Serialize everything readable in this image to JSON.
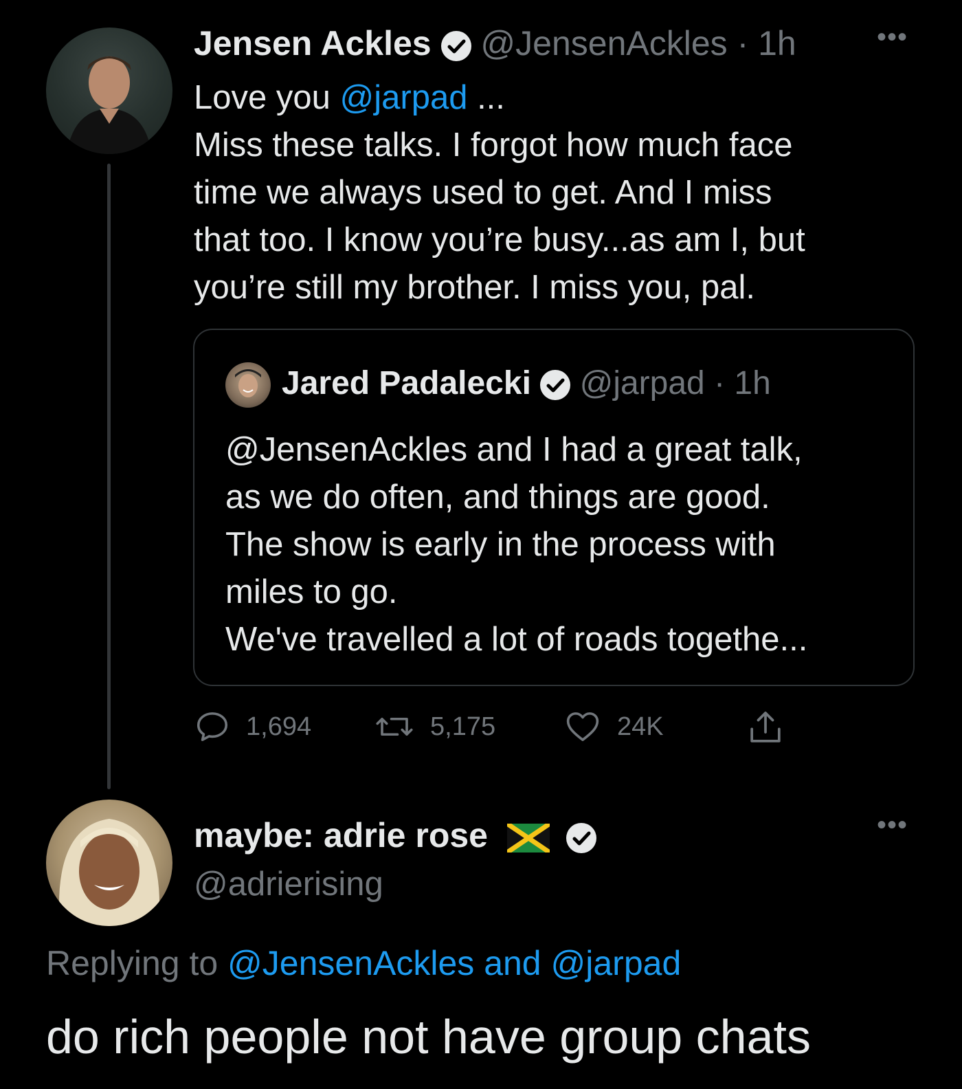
{
  "tweet": {
    "author_name": "Jensen Ackles",
    "author_handle": "@JensenAckles",
    "time": "· 1h",
    "more_label": "•••",
    "text_prefix": "Love you ",
    "mention": "@jarpad",
    "text_suffix": " ...",
    "lines": [
      "Miss these talks. I forgot how much face",
      "time we always used to get.  And I miss",
      "that too. I know you’re busy...as am I, but",
      "you’re still my brother.  I miss you, pal."
    ],
    "stats": {
      "replies": "1,694",
      "retweets": "5,175",
      "likes": "24K"
    }
  },
  "quoted": {
    "author_name": "Jared Padalecki",
    "author_handle": "@jarpad",
    "time": "· 1h",
    "lines": [
      "@JensenAckles and I had a great talk,",
      "as we do often, and things are good.",
      "The show is early in the process with",
      "miles to go.",
      "We've travelled a lot of roads togethe..."
    ]
  },
  "reply": {
    "author_name": "maybe: adrie rose",
    "author_handle": "@adrierising",
    "more_label": "•••",
    "replying_prefix": "Replying to ",
    "replying_to": "@JensenAckles and @jarpad",
    "text": "do rich people not have group chats"
  },
  "colors": {
    "background": "#000000",
    "text": "#e7e9ea",
    "muted": "#71767b",
    "link": "#1d9bf0",
    "border": "#2f3336"
  },
  "icons": {
    "reply": "reply-icon",
    "retweet": "retweet-icon",
    "like": "heart-icon",
    "share": "share-icon",
    "verified": "verified-badge-icon",
    "flag": "jamaica-flag-icon"
  }
}
